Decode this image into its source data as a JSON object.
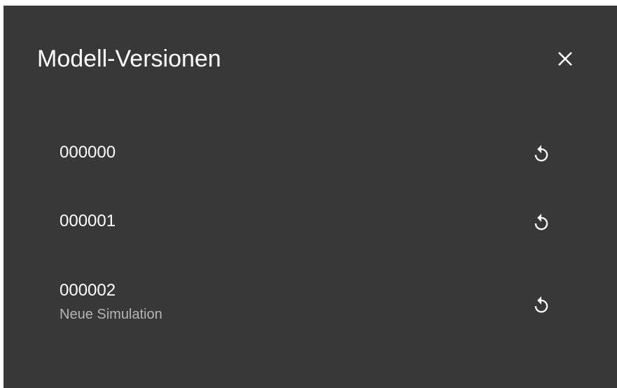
{
  "dialog": {
    "title": "Modell-Versionen",
    "close_icon": "close-icon"
  },
  "versions": [
    {
      "name": "000000",
      "description": "",
      "action_icon": "restore-icon"
    },
    {
      "name": "000001",
      "description": "",
      "action_icon": "restore-icon"
    },
    {
      "name": "000002",
      "description": "Neue Simulation",
      "action_icon": "restore-icon"
    }
  ],
  "colors": {
    "background": "#383838",
    "text": "#ffffff",
    "secondary_text": "#b5b5b5"
  }
}
